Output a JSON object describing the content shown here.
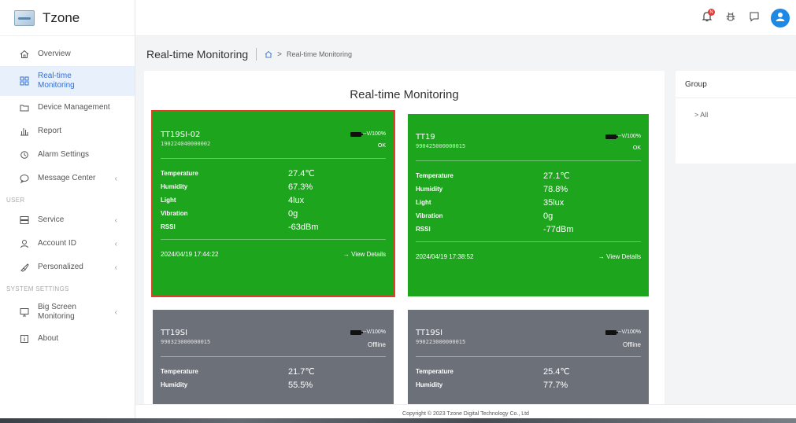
{
  "app": {
    "name": "Tzone"
  },
  "sidebar": {
    "items": [
      {
        "label": "Overview",
        "icon": "home-icon"
      },
      {
        "label": "Real-time Monitoring",
        "icon": "grid-icon",
        "active": true
      },
      {
        "label": "Device Management",
        "icon": "folder-icon"
      },
      {
        "label": "Report",
        "icon": "bar-chart-icon"
      },
      {
        "label": "Alarm Settings",
        "icon": "alarm-icon"
      },
      {
        "label": "Message Center",
        "icon": "message-icon",
        "chevron": "‹"
      }
    ],
    "section_user": "USER",
    "user_items": [
      {
        "label": "Service",
        "icon": "server-icon",
        "chevron": "‹"
      },
      {
        "label": "Account ID",
        "icon": "user-icon",
        "chevron": "‹"
      },
      {
        "label": "Personalized",
        "icon": "brush-icon",
        "chevron": "‹"
      }
    ],
    "section_system": "SYSTEM SETTINGS",
    "system_items": [
      {
        "label": "Big Screen Monitoring",
        "icon": "monitor-icon",
        "chevron": "‹"
      },
      {
        "label": "About",
        "icon": "info-icon"
      }
    ]
  },
  "topbar": {
    "notification_badge": "N",
    "icons": [
      "bell-icon",
      "bug-icon",
      "chat-icon",
      "avatar-icon"
    ],
    "accent": "#1e88e5"
  },
  "breadcrumb": {
    "title": "Real-time Monitoring",
    "current": "Real-time Monitoring"
  },
  "main": {
    "title": "Real-time Monitoring",
    "row_labels": {
      "temperature": "Temperature",
      "humidity": "Humidity",
      "light": "Light",
      "vibration": "Vibration",
      "rssi": "RSSI"
    },
    "view_details": "→ View Details",
    "cards": [
      {
        "name": "TT19SI-02",
        "id": "190224040000002",
        "battery": "--V/100%",
        "status": "OK",
        "temperature": "27.4℃",
        "humidity": "67.3%",
        "light": "4lux",
        "vibration": "0g",
        "rssi": "-63dBm",
        "time": "2024/04/19 17:44:22",
        "color": "#1ea51e"
      },
      {
        "name": "TT19",
        "id": "990425000000015",
        "battery": "--V/100%",
        "status": "OK",
        "temperature": "27.1℃",
        "humidity": "78.8%",
        "light": "35lux",
        "vibration": "0g",
        "rssi": "-77dBm",
        "time": "2024/04/19 17:38:52",
        "color": "#1ea51e"
      },
      {
        "name": "TT19SI",
        "id": "990323000000015",
        "battery": "--V/100%",
        "status": "Offline",
        "temperature": "21.7℃",
        "humidity": "55.5%",
        "color": "#6b7079"
      },
      {
        "name": "TT19SI",
        "id": "990223000000015",
        "battery": "--V/100%",
        "status": "Offline",
        "temperature": "25.4℃",
        "humidity": "77.7%",
        "color": "#6b7079"
      }
    ]
  },
  "group": {
    "title": "Group",
    "items": [
      {
        "label": "> All"
      }
    ]
  },
  "footer": {
    "copyright": "Copyright © 2023 Tzone Digital Technology Co., Ltd"
  }
}
